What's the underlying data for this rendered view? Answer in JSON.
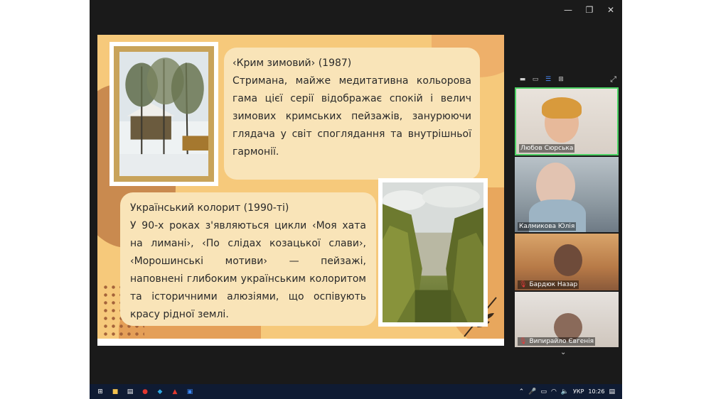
{
  "window": {
    "minimize_glyph": "—",
    "restore_glyph": "❐",
    "close_glyph": "✕"
  },
  "slide": {
    "section1": {
      "title": "‹Крим зимовий› (1987)",
      "body": "Стримана, майже медитативна кольорова гама цієї серії відображає спокій і велич зимових кримських пейзажів, занурюючи глядача у світ споглядання та внутрішньої гармонії."
    },
    "section2": {
      "title": "Український колорит (1990-ті)",
      "body": "У 90-х роках з'являються цикли ‹Моя хата на лимані›, ‹По слідах козацької слави›, ‹Морошинські мотиви› — пейзажі, наповнені глибоким українським колоритом та історичними алюзіями, що оспівують красу рідної землі."
    }
  },
  "participants": [
    {
      "name": "Любов Сюрська",
      "muted": false,
      "active_speaker": true
    },
    {
      "name": "Калмикова Юлія",
      "muted": false,
      "active_speaker": false
    },
    {
      "name": "Бардюк Назар",
      "muted": true,
      "active_speaker": false
    },
    {
      "name": "Випирайло Євгенія",
      "muted": true,
      "active_speaker": false
    }
  ],
  "taskbar": {
    "language": "УКР",
    "time": "10:26"
  },
  "colors": {
    "slide_bg": "#f6c97b",
    "card_bg": "#f9e4b8",
    "active_speaker_border": "#4cd264",
    "taskbar_bg": "#0f1b33"
  }
}
